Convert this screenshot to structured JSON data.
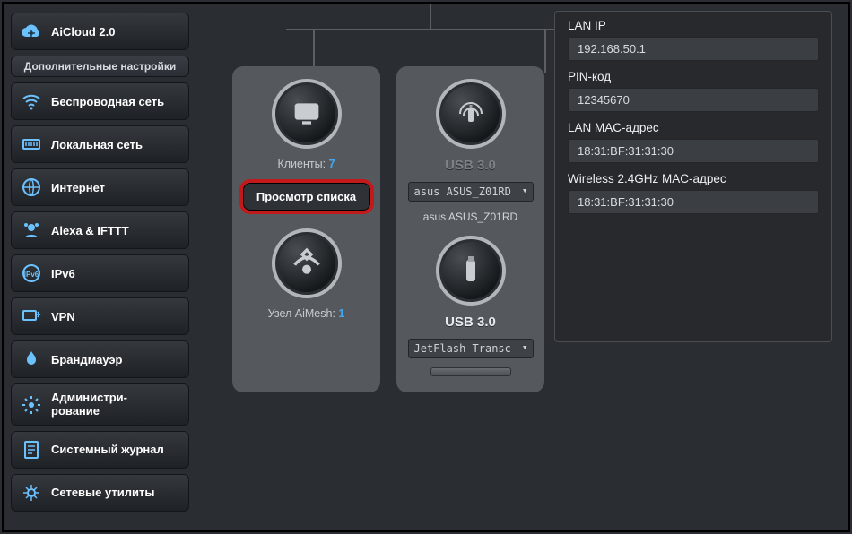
{
  "sidebar": {
    "aicloud": "AiCloud 2.0",
    "section_header": "Дополнительные настройки",
    "items": [
      "Беспроводная сеть",
      "Локальная сеть",
      "Интернет",
      "Alexa & IFTTT",
      "IPv6",
      "VPN",
      "Брандмауэр",
      "Администри-\nрование",
      "Системный журнал",
      "Сетевые утилиты"
    ]
  },
  "clients_card": {
    "label": "Клиенты:",
    "count": "7",
    "view_list": "Просмотр списка",
    "aimesh_label": "Узел AiMesh:",
    "aimesh_count": "1"
  },
  "usb_card": {
    "usb30_top": "USB 3.0",
    "select_top": "asus ASUS_Z01RD",
    "device_text": "asus ASUS_Z01RD",
    "usb30_bottom": "USB 3.0",
    "select_bottom": "JetFlash Transc"
  },
  "info": {
    "rows": [
      {
        "label": "LAN IP",
        "value": "192.168.50.1"
      },
      {
        "label": "PIN-код",
        "value": "12345670"
      },
      {
        "label": "LAN MAC-адрес",
        "value": "18:31:BF:31:31:30"
      },
      {
        "label": "Wireless 2.4GHz MAC-адрес",
        "value": "18:31:BF:31:31:30"
      }
    ]
  }
}
